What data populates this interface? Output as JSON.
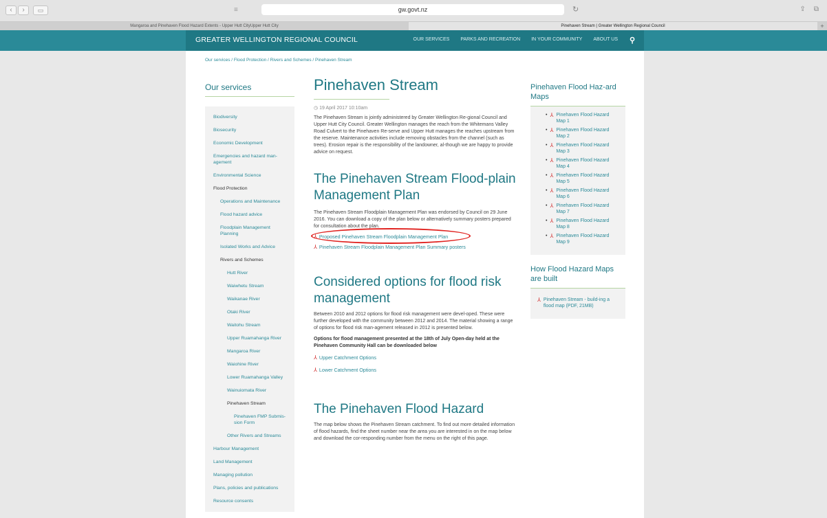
{
  "browser": {
    "url": "gw.govt.nz",
    "tabs": [
      "Mangaroa and Pinehaven Flood Hazard Extents - Upper Hutt CityUpper Hutt City",
      "Pinehaven Stream | Greater Wellington Regional Council"
    ]
  },
  "header": {
    "logo": "GREATER WELLINGTON REGIONAL COUNCIL",
    "nav": [
      "OUR SERVICES",
      "PARKS AND RECREATION",
      "IN YOUR COMMUNITY",
      "ABOUT US"
    ]
  },
  "breadcrumb": "Our services / Flood Protection / Rivers and Schemes / Pinehaven Stream",
  "left_nav": {
    "title": "Our services",
    "items": [
      "Biodiversity",
      "Biosecurity",
      "Economic Development",
      "Emergencies and hazard man-agement",
      "Environmental Science",
      "Flood Protection",
      "Operations and Maintenance",
      "Flood hazard advice",
      "Floodplain Management Planning",
      "Isolated Works and Advice",
      "Rivers and Schemes",
      "Hutt River",
      "Waiwhetu Stream",
      "Waikanae River",
      "Otaki River",
      "Waitohu Stream",
      "Upper Ruamahanga River",
      "Mangaroa River",
      "Waiohine River",
      "Lower Ruamahanga Valley",
      "Wainuiomata River",
      "Pinehaven Stream",
      "Pinehaven FMP Submis-sion Form",
      "Other Rivers and Streams",
      "Harbour Management",
      "Land Management",
      "Managing pollution",
      "Plans, policies and publications",
      "Resource consents"
    ]
  },
  "main": {
    "title": "Pinehaven Stream",
    "date": "19 April 2017 10:10am",
    "intro": "The Pinehaven Stream is jointly administered by Greater Wellington Re-gional Council and Upper Hutt City Council. Greater Wellington manages the reach from the Whitemans Valley Road Culvert to the Pinehaven Re-serve and Upper Hutt manages the reaches upstream from the reserve. Maintenance activities include removing obstacles from the channel (such as trees). Erosion repair is the responsibility of the landowner, al-though we are happy to provide advice on request.",
    "section1_title": "The Pinehaven Stream Flood-plain Management Plan",
    "section1_text": "The Pinehaven Stream Floodplain Management Plan was endorsed by Council on 29 June 2016. You can download a copy of the plan below or alternatively summary posters prepared for consultation about the plan.",
    "section1_links": [
      "Proposed Pinehaven Stream Floodplain Management Plan",
      "Pinehaven Stream Floodplain Management Plan Summary posters"
    ],
    "section2_title": "Considered options for flood risk management",
    "section2_text": "Between 2010 and 2012 options for flood risk management were devel-oped. These were further developed with the community between 2012 and 2014. The material showing a range of options for flood risk man-agement released in 2012 is presented below.",
    "section2_bold": "Options for flood management presented at the 18th of July Open-day held at the Pinehaven Community Hall can be downloaded below",
    "section2_links": [
      "Upper Catchment Options",
      "Lower Catchment Options"
    ],
    "section3_title": "The Pinehaven Flood Hazard",
    "section3_text": "The map below shows the Pinehaven Stream catchment. To find out more detailed information of flood hazards, find the sheet number near the area you are interested in on the map below and download the cor-responding number from the menu on the right of this page."
  },
  "right": {
    "maps_title": "Pinehaven Flood Haz-ard Maps",
    "maps": [
      "Pinehaven Flood Hazard Map 1",
      "Pinehaven Flood Hazard Map 2",
      "Pinehaven Flood Hazard Map 3",
      "Pinehaven Flood Hazard Map 4",
      "Pinehaven Flood Hazard Map 5",
      "Pinehaven Flood Hazard Map 6",
      "Pinehaven Flood Hazard Map 7",
      "Pinehaven Flood Hazard Map 8",
      "Pinehaven Flood Hazard Map 9"
    ],
    "build_title": "How Flood Hazard Maps are built",
    "build_link": "Pinehaven Stream - build-ing a flood map (PDF, 21MB)"
  }
}
